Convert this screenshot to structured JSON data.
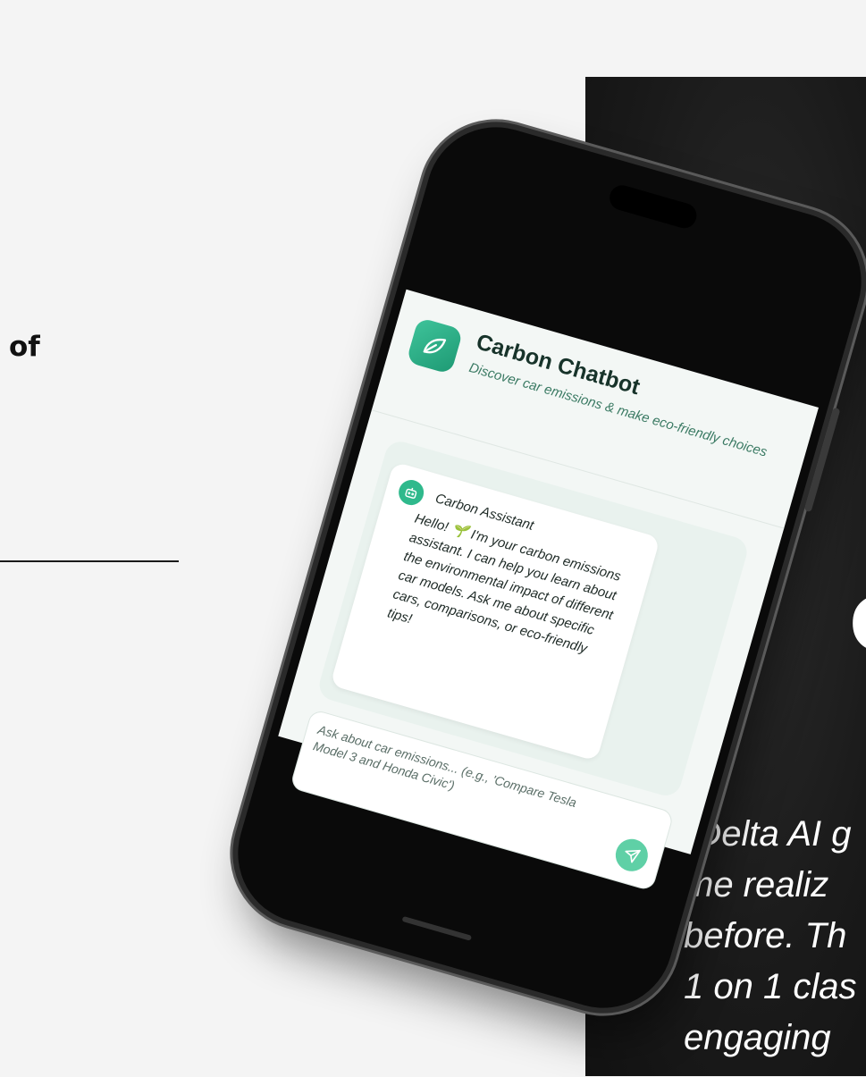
{
  "left": {
    "fragment": "of"
  },
  "panel": {
    "big_letter": "C",
    "quote_lines": [
      "“Delta AI g",
      "me realiz",
      "before. Th",
      "1 on 1 clas",
      "engaging"
    ]
  },
  "app": {
    "title": "Carbon Chatbot",
    "subtitle": "Discover car emissions & make eco-friendly choices",
    "icon": "leaf-icon",
    "assistant_name": "Carbon Assistant",
    "assistant_icon": "bot-icon",
    "assistant_message": "Hello! 🌱 I'm your carbon emissions assistant. I can help you learn about the environmental impact of different car models. Ask me about specific cars, comparisons, or eco-friendly tips!",
    "input_placeholder": "Ask about car emissions... (e.g., 'Compare Tesla Model 3 and Honda Civic')",
    "send_icon": "send-icon"
  },
  "colors": {
    "accent": "#2fb98c",
    "dark_panel": "#1a1a1a"
  }
}
